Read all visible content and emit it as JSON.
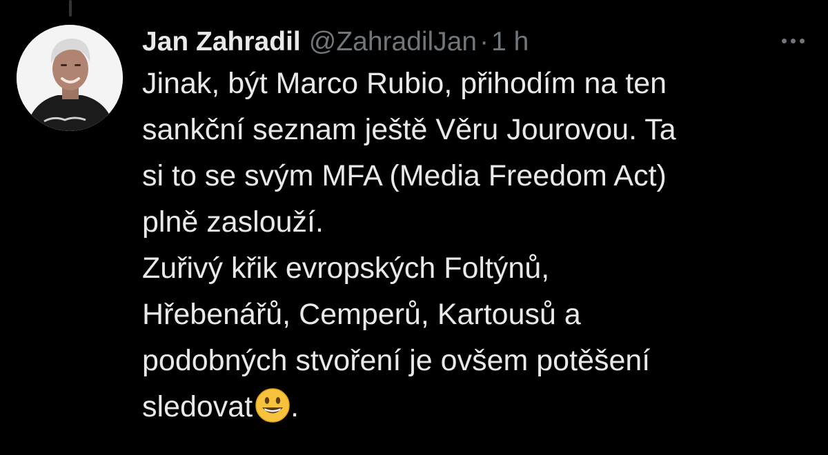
{
  "thread": {
    "author": {
      "name": "Jan Zahradil",
      "handle": "@ZahradilJan",
      "separator": "·",
      "time": "1 h",
      "avatar_icon": "profile-photo"
    },
    "more_icon": "more-horizontal-icon",
    "tweet": {
      "lines": [
        "Jinak, být Marco Rubio, přihodím na ten",
        "sankční seznam ještě Věru Jourovou. Ta",
        "si to se svým MFA (Media Freedom Act)",
        "plně zaslouží.",
        "Zuřivý křik evropských Foltýnů,",
        "Hřebenářů, Cemperů, Kartousů a",
        "podobných stvoření je ovšem potěšení",
        "sledovat"
      ],
      "final_punctuation": ".",
      "emoji": "grinning-face-emoji"
    }
  },
  "colors": {
    "background": "#000000",
    "text_primary": "#e7e9ea",
    "text_secondary": "#71767b",
    "thread_line": "#333639",
    "emoji_face": "#f7c23c"
  }
}
